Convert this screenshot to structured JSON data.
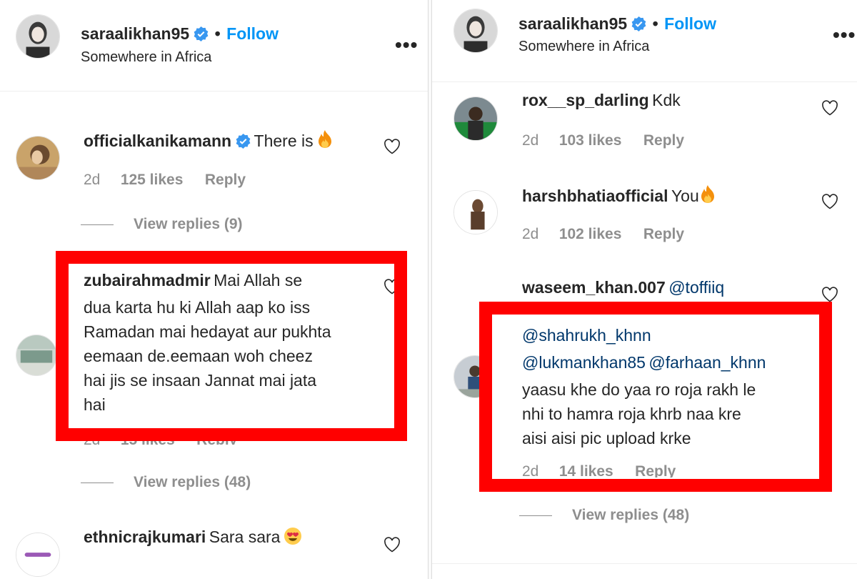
{
  "left": {
    "header": {
      "username": "saraalikhan95",
      "follow": "Follow",
      "separator": "•",
      "location": "Somewhere in Africa",
      "more": "•••"
    },
    "comments": [
      {
        "username": "officialkanikamann",
        "text": "There is",
        "time": "2d",
        "likes": "125 likes",
        "reply": "Reply",
        "view_replies": "View replies (9)"
      },
      {
        "username": "zubairahmadmir",
        "text_lines": [
          "Mai Allah se",
          "dua karta hu ki Allah aap ko iss",
          "Ramadan mai hedayat aur pukhta",
          "eemaan de.eemaan woh cheez",
          "hai jis se insaan Jannat mai jata",
          "hai"
        ],
        "time": "2d",
        "likes": "15 likes",
        "reply": "Reply",
        "view_replies": "View replies (48)"
      },
      {
        "username": "ethnicrajkumari",
        "text": "Sara sara"
      }
    ]
  },
  "right": {
    "header": {
      "username": "saraalikhan95",
      "follow": "Follow",
      "separator": "•",
      "location": "Somewhere in Africa",
      "more": "•••"
    },
    "comments": [
      {
        "username": "rox__sp_darling",
        "text": "Kdk",
        "time": "2d",
        "likes": "103 likes",
        "reply": "Reply"
      },
      {
        "username": "harshbhatiaofficial",
        "text": "You",
        "time": "2d",
        "likes": "102 likes",
        "reply": "Reply"
      },
      {
        "username": "waseem_khan.007",
        "mention_1": "@toffiiq",
        "mention_2": "@shahrukh_khnn",
        "mention_3": "@lukmankhan85",
        "mention_4": "@farhaan_khnn",
        "text_lines": [
          "yaasu khe do yaa ro roja rakh le",
          "nhi to hamra roja khrb naa kre",
          "aisi aisi pic upload krke"
        ],
        "time": "2d",
        "likes": "14 likes",
        "reply": "Reply",
        "view_replies": "View replies (48)"
      }
    ]
  },
  "colors": {
    "highlight": "#ff0000",
    "follow": "#0095f6",
    "mention": "#00376b",
    "meta": "#8e8e8e",
    "verified": "#3897f0"
  },
  "icons": [
    "verified-badge-icon",
    "heart-icon",
    "fire-emoji-icon",
    "heart-eyes-emoji-icon",
    "more-options-icon"
  ]
}
